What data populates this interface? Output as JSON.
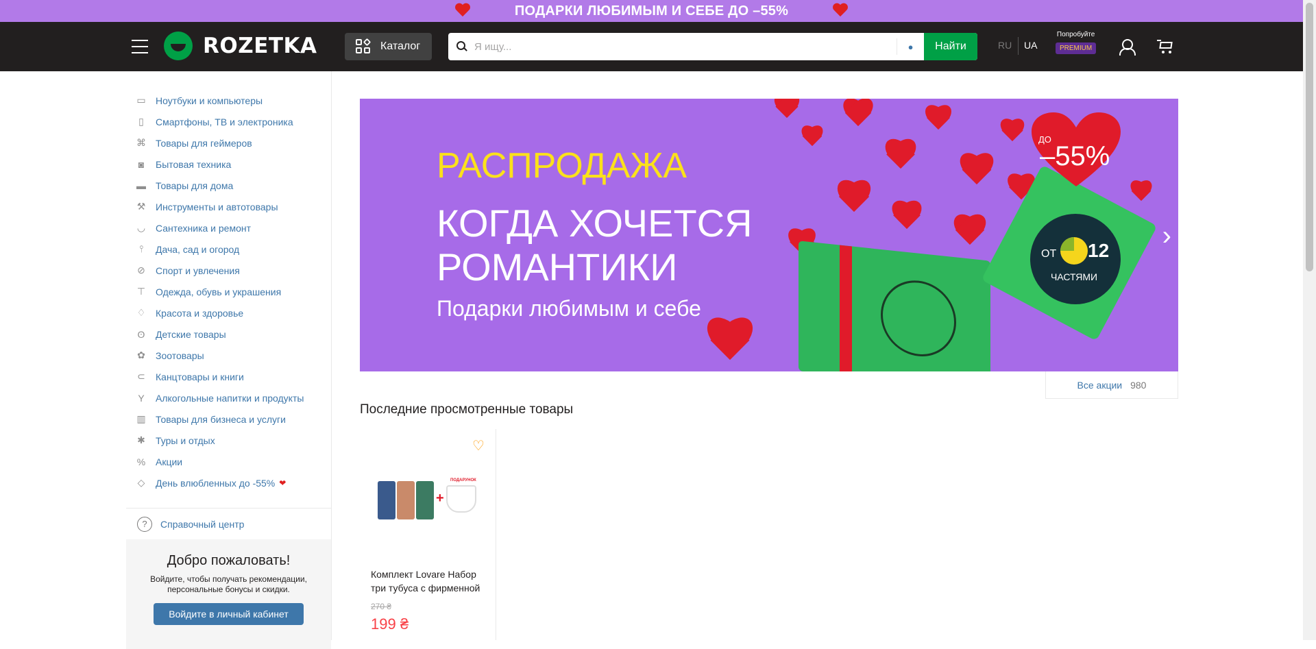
{
  "promo_bar": {
    "text": "ПОДАРКИ ЛЮБИМЫМ И СЕБЕ ДО –55%"
  },
  "header": {
    "logo_text": "ROZETKA",
    "catalog_label": "Каталог",
    "search": {
      "placeholder": "Я ищу...",
      "value": ""
    },
    "find_label": "Найти",
    "languages": [
      "RU",
      "UA"
    ],
    "active_language": "UA",
    "premium_try": "Попробуйте",
    "premium_badge": "PREMIUM"
  },
  "sidebar": {
    "items": [
      {
        "label": "Ноутбуки и компьютеры",
        "icon": "laptop-icon"
      },
      {
        "label": "Смартфоны, ТВ и электроника",
        "icon": "smartphone-icon"
      },
      {
        "label": "Товары для геймеров",
        "icon": "gamepad-icon"
      },
      {
        "label": "Бытовая техника",
        "icon": "washing-machine-icon"
      },
      {
        "label": "Товары для дома",
        "icon": "sofa-icon"
      },
      {
        "label": "Инструменты и автотовары",
        "icon": "drill-icon"
      },
      {
        "label": "Сантехника и ремонт",
        "icon": "bathtub-icon"
      },
      {
        "label": "Дача, сад и огород",
        "icon": "garden-tools-icon"
      },
      {
        "label": "Спорт и увлечения",
        "icon": "racket-icon"
      },
      {
        "label": "Одежда, обувь и украшения",
        "icon": "tshirt-icon"
      },
      {
        "label": "Красота и здоровье",
        "icon": "cosmetics-icon"
      },
      {
        "label": "Детские товары",
        "icon": "teddy-bear-icon"
      },
      {
        "label": "Зоотовары",
        "icon": "paw-icon"
      },
      {
        "label": "Канцтовары и книги",
        "icon": "paperclip-icon"
      },
      {
        "label": "Алкогольные напитки и продукты",
        "icon": "glass-icon"
      },
      {
        "label": "Товары для бизнеса и услуги",
        "icon": "barcode-icon"
      },
      {
        "label": "Туры и отдых",
        "icon": "palm-tree-icon"
      },
      {
        "label": "Акции",
        "icon": "percent-icon"
      },
      {
        "label": "День влюбленных до -55%",
        "icon": "tag-icon"
      }
    ],
    "help_label": "Справочный центр",
    "welcome_title": "Добро пожаловать!",
    "welcome_text": "Войдите, чтобы получать рекомендации, персональные бонусы и скидки.",
    "login_label": "Войдите в личный кабинет"
  },
  "banner": {
    "line1": "РАСПРОДАЖА",
    "line2": "КОГДА ХОЧЕТСЯ",
    "line3": "РОМАНТИКИ",
    "line4": "Подарки любимым и себе",
    "sale_prefix": "ДО",
    "sale_value": "–55%",
    "parts_prefix": "ОТ",
    "parts_number": "12",
    "parts_label": "ЧАСТЯМИ"
  },
  "promotions": {
    "label": "Все акции",
    "count": "980"
  },
  "recent": {
    "title": "Последние просмотренные товары",
    "products": [
      {
        "name": "Комплект Lovare Набор три тубуса с фирменной",
        "old_price": "270 ₴",
        "price": "199 ₴",
        "gift_label": "ПОДАРУНОК"
      }
    ]
  },
  "colors": {
    "brand_green": "#00a046",
    "promo_purple": "#b27ae8",
    "link_blue": "#3e77aa",
    "price_red": "#f84147",
    "header_dark": "#221f1f"
  }
}
